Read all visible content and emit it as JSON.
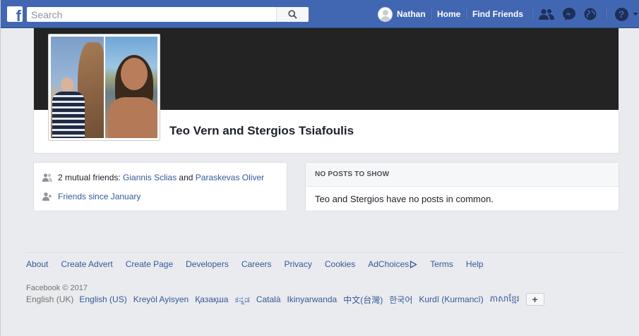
{
  "header": {
    "logo_letter": "f",
    "search_placeholder": "Search",
    "user_name": "Nathan",
    "nav_home": "Home",
    "nav_find_friends": "Find Friends",
    "help_glyph": "?",
    "icons": [
      "friend-requests-icon",
      "messenger-icon",
      "notifications-globe-icon",
      "help-icon",
      "account-menu-arrow-icon"
    ]
  },
  "profile": {
    "name": "Teo Vern and Stergios Tsiafoulis"
  },
  "mutual": {
    "prefix": "2 mutual friends: ",
    "friend1": "Giannis Sclias",
    "and": " and ",
    "friend2": "Paraskevas Oliver",
    "friends_since": "Friends since January"
  },
  "posts": {
    "heading": "NO POSTS TO SHOW",
    "message": "Teo and Stergios have no posts in common."
  },
  "footer": {
    "links": [
      "About",
      "Create Advert",
      "Create Page",
      "Developers",
      "Careers",
      "Privacy",
      "Cookies",
      "AdChoices",
      "Terms",
      "Help"
    ],
    "copyright": "Facebook © 2017",
    "current_language": "English (UK)",
    "languages": [
      "English (US)",
      "Kreyòl Ayisyen",
      "Қазақша",
      "ಕನ್ನಡ",
      "Català",
      "Ikinyarwanda",
      "中文(台灣)",
      "한국어",
      "Kurdî (Kurmancî)",
      "ភាសាខ្មែរ"
    ],
    "add_language": "+"
  },
  "colors": {
    "brand_blue": "#4267b2",
    "link_blue": "#365899",
    "background": "#e9ebee"
  }
}
